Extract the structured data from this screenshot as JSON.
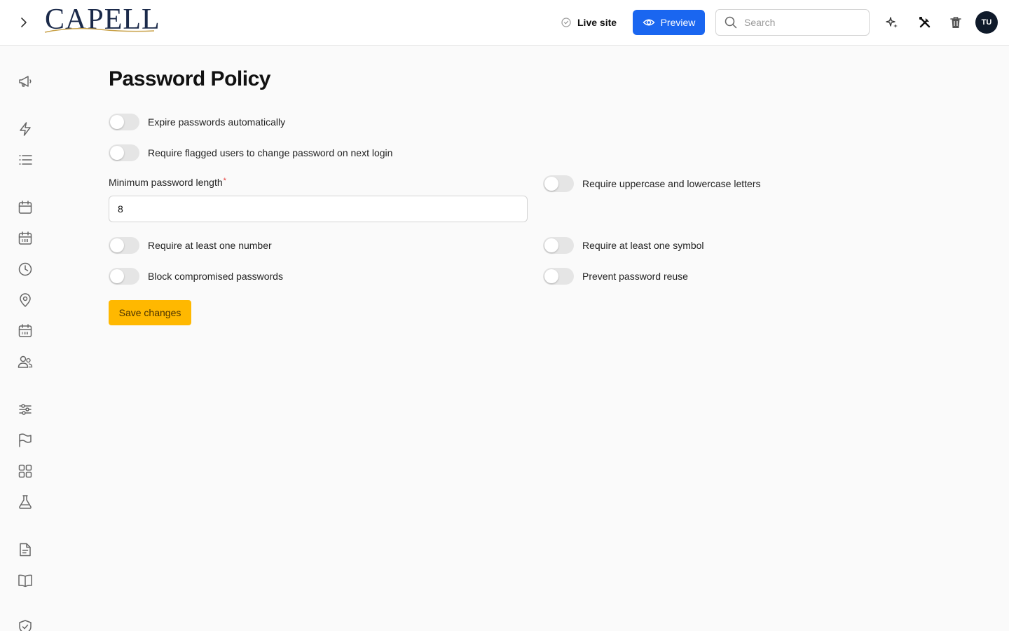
{
  "header": {
    "logo_text": "CAPELL",
    "live_site_label": "Live site",
    "preview_label": "Preview",
    "search_placeholder": "Search",
    "avatar_initials": "TU"
  },
  "page": {
    "title": "Password Policy"
  },
  "toggles": {
    "expire": {
      "label": "Expire passwords automatically",
      "on": false
    },
    "flagged": {
      "label": "Require flagged users to change password on next login",
      "on": false
    },
    "case": {
      "label": "Require uppercase and lowercase letters",
      "on": false
    },
    "number": {
      "label": "Require at least one number",
      "on": false
    },
    "symbol": {
      "label": "Require at least one symbol",
      "on": false
    },
    "compromised": {
      "label": "Block compromised passwords",
      "on": false
    },
    "reuse": {
      "label": "Prevent password reuse",
      "on": false
    }
  },
  "min_length": {
    "label": "Minimum password length",
    "required_mark": "*",
    "value": "8"
  },
  "save_label": "Save changes",
  "colors": {
    "accent": "#1a66f0",
    "save": "#ffb800",
    "toggle_off": "#e5e5e5"
  }
}
